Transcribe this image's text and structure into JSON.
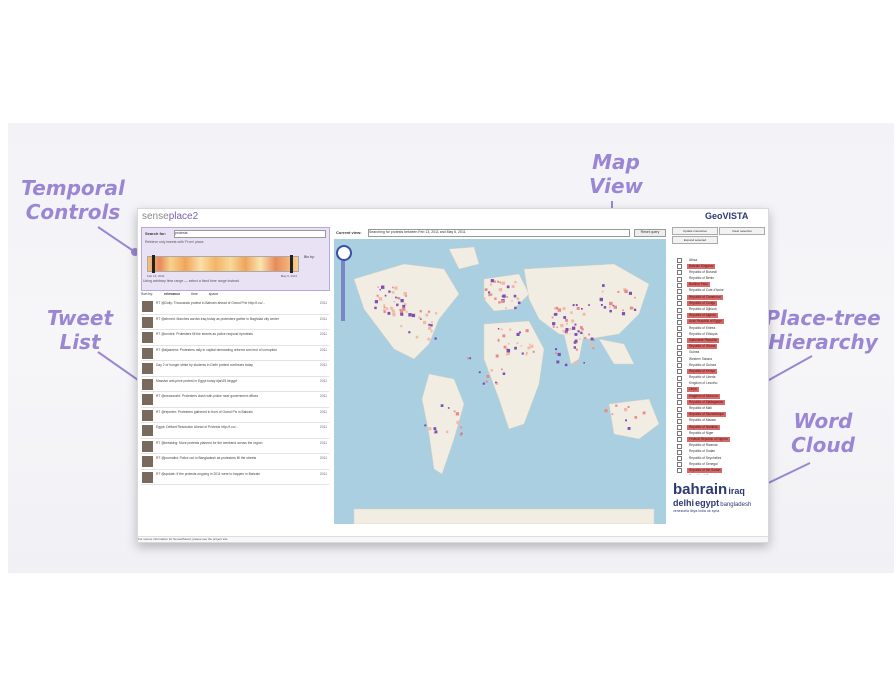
{
  "annotations": {
    "temporal_controls": "Temporal\nControls",
    "map_view": "Map\nView",
    "tweet_list": "Tweet\nList",
    "place_tree": "Place-tree\nHierarchy",
    "word_cloud": "Word\nCloud"
  },
  "app": {
    "brand_a": "sense",
    "brand_b": "place2",
    "search_label": "Search for:",
    "search_value": "protests",
    "checkbox_label": "Retrieve only tweets with 'From' place",
    "date_start": "Feb 13, 2011",
    "date_end": "May 6, 2011",
    "bin_by": "Bin by:",
    "note": "Using arbitrary time range — select a fixed time range instead",
    "sort_label": "Sort by:",
    "sort_options": [
      "relevance",
      "time",
      "space"
    ],
    "zoom_label": "Current view:",
    "zoom_value": "Searching for protests between Feb 13, 2011 and May 6, 2011",
    "reset_button": "Reset query",
    "map_footer": "Leaflet | Tiles",
    "geovista": "GeoVISTA",
    "right_buttons": [
      "Update interactive",
      "Clear selection",
      "Expand selected"
    ],
    "bottom_text": "For source information for SensePlace2, please see the project site"
  },
  "tweets": [
    {
      "text": "RT @Dolly: Thousands protest in Bahrain ahead of Grand Prix http://t.co/...",
      "date": "2011"
    },
    {
      "text": "RT @ahmed: Marches across Iraq today as protesters gather in Baghdad city center",
      "date": "2011"
    },
    {
      "text": "RT @cnnbrk: Protesters fill the streets as police respond #protests",
      "date": "2011"
    },
    {
      "text": "RT @aljazeera: Protesters rally in capital demanding reforms and end of corruption",
      "date": "2011"
    },
    {
      "text": "Day 2 of hunger strike by students in Delhi protest continues today",
      "date": "2011"
    },
    {
      "text": "Massive anti-price protest in Egypt today #jan25 #egypt",
      "date": "2011"
    },
    {
      "text": "RT @newsworld: Protesters clash with police near government offices",
      "date": "2011"
    },
    {
      "text": "RT @reporter: Protesters gathered in front of Grand Pix in Bahrain",
      "date": "2011"
    },
    {
      "text": "Egypt: Defiant Resolution Ahead of Protests http://t.co/...",
      "date": "2011"
    },
    {
      "text": "RT @breaking: More protests planned for the weekend across the region",
      "date": "2011"
    },
    {
      "text": "RT @journalist: Police out in Bangladesh as protesters fill the streets",
      "date": "2011"
    },
    {
      "text": "RT @update: If the protests ongoing in 2011 were to happen in Bahrain",
      "date": "2011"
    }
  ],
  "tree": [
    {
      "label": "Africa",
      "hl": false
    },
    {
      "label": "Bahrain Kingdom",
      "hl": true
    },
    {
      "label": "Republic of Burundi",
      "hl": false
    },
    {
      "label": "Republic of Benin",
      "hl": false
    },
    {
      "label": "Burkina Faso",
      "hl": true
    },
    {
      "label": "Republic of Cote d'Ivoire",
      "hl": false
    },
    {
      "label": "Republic of Cameroon",
      "hl": true
    },
    {
      "label": "Republic of Congo",
      "hl": true
    },
    {
      "label": "Republic of Djibouti",
      "hl": false
    },
    {
      "label": "Republic of Algeria",
      "hl": true
    },
    {
      "label": "Arab Republic of Egypt",
      "hl": true
    },
    {
      "label": "Republic of Eritrea",
      "hl": false
    },
    {
      "label": "Republic of Ethiopia",
      "hl": false
    },
    {
      "label": "Gabonese Republic",
      "hl": true
    },
    {
      "label": "Republic of Ghana",
      "hl": true
    },
    {
      "label": "Guinea",
      "hl": false
    },
    {
      "label": "Western Sahara",
      "hl": false
    },
    {
      "label": "Republic of Guinea",
      "hl": false
    },
    {
      "label": "Republic of Kenya",
      "hl": true
    },
    {
      "label": "Republic of Liberia",
      "hl": false
    },
    {
      "label": "Kingdom of Lesotho",
      "hl": false
    },
    {
      "label": "Libya",
      "hl": true
    },
    {
      "label": "Kingdom of Morocco",
      "hl": true
    },
    {
      "label": "Republic of Madagascar",
      "hl": true
    },
    {
      "label": "Republic of Mali",
      "hl": false
    },
    {
      "label": "Republic of Mozambique",
      "hl": true
    },
    {
      "label": "Republic of Malawi",
      "hl": false
    },
    {
      "label": "Republic of Namibia",
      "hl": true
    },
    {
      "label": "Republic of Niger",
      "hl": false
    },
    {
      "label": "Federal Republic of Nigeria",
      "hl": true
    },
    {
      "label": "Republic of Rwanda",
      "hl": false
    },
    {
      "label": "Republic of Sudan",
      "hl": false
    },
    {
      "label": "Republic of Seychelles",
      "hl": false
    },
    {
      "label": "Republic of Senegal",
      "hl": false
    },
    {
      "label": "Republic of the Sudan",
      "hl": true
    },
    {
      "label": "Republic of Sierra Leone",
      "hl": false
    }
  ],
  "cloud": {
    "w1a": "bahrain",
    "w1b": "iraq",
    "w2a": "delhi",
    "w2b": "egypt",
    "w3a": "bangladesh",
    "w4a": "venezuela",
    "w4b": "libya",
    "w4c": "india",
    "w4d": "uk",
    "w4e": "syria"
  },
  "colors": {
    "accent": "#9b86d4",
    "map_water": "#a9cfe0",
    "map_land": "#f1ede3",
    "highlight": "#d46a6a"
  }
}
